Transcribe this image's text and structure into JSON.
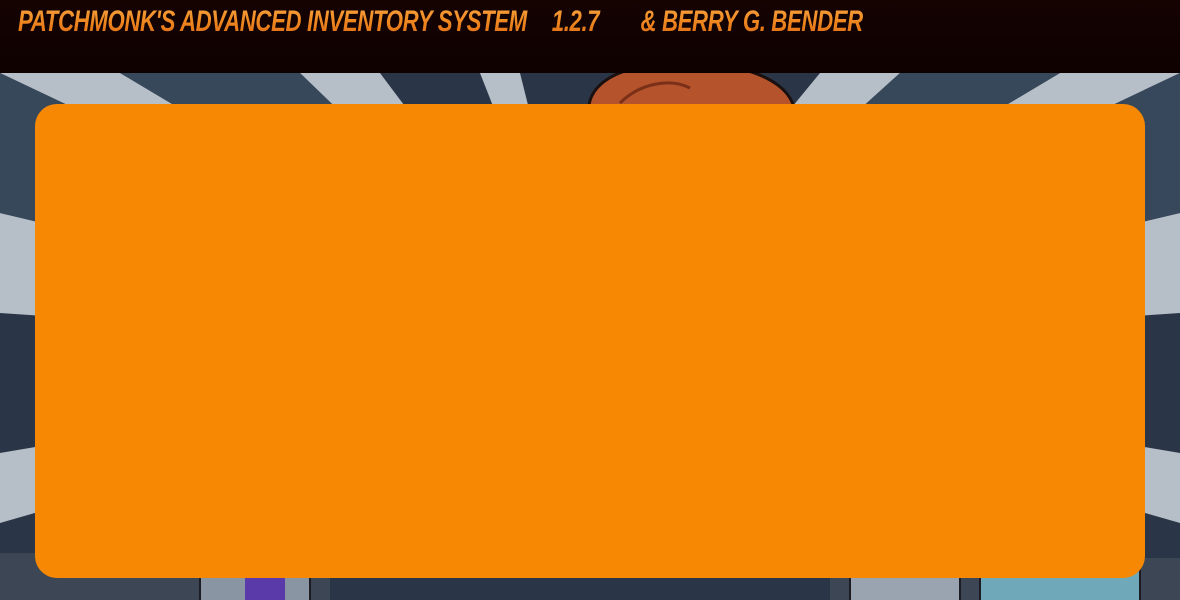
{
  "header": {
    "title": "Patchmonk's Advanced Inventory System",
    "version": "1.2.7",
    "credit": "& Berry G. Bender"
  },
  "colors": {
    "header_bg": "#120201",
    "title_orange": "#f28a1d",
    "panel_orange": "#f78803",
    "backdrop_blue": "#24303f"
  },
  "backdrop": {
    "description_icon": "comic-illustration-background"
  }
}
